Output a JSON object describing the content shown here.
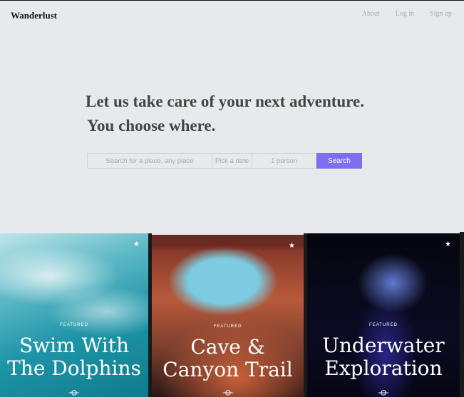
{
  "header": {
    "brand": "Wanderlust",
    "nav": [
      "About",
      "Log in",
      "Sign up"
    ]
  },
  "hero": {
    "line1": "Let us take care of your next adventure.",
    "line2": "You choose where."
  },
  "search": {
    "place_placeholder": "Search for a place, any place",
    "date_placeholder": "Pick a date",
    "people_value": "1 person",
    "button_label": "Search",
    "accent": "#7b6fef"
  },
  "cards": [
    {
      "badge": "FEATURED",
      "title_line1": "Swim With",
      "title_line2": "The Dolphins",
      "icon": "star-icon"
    },
    {
      "badge": "FEATURED",
      "title_line1": "Cave &",
      "title_line2": "Canyon Trail",
      "icon": "star-icon"
    },
    {
      "badge": "FEATURED",
      "title_line1": "Underwater",
      "title_line2": "Exploration",
      "icon": "star-icon"
    }
  ]
}
